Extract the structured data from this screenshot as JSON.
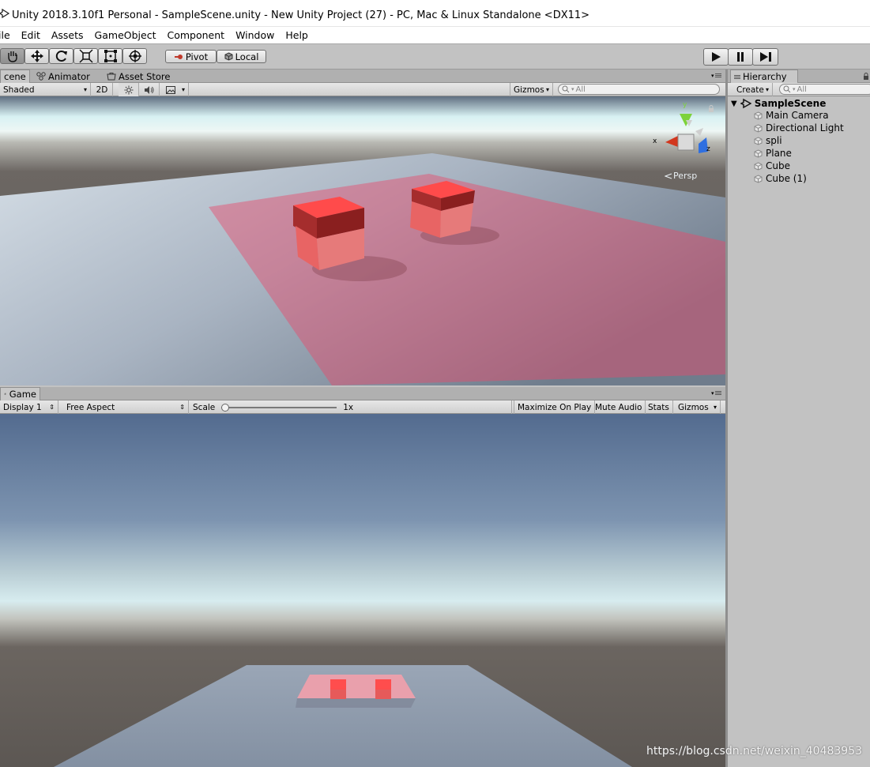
{
  "window": {
    "title": "Unity 2018.3.10f1 Personal - SampleScene.unity - New Unity Project (27) - PC, Mac & Linux Standalone <DX11>"
  },
  "menubar": {
    "items": [
      "ile",
      "Edit",
      "Assets",
      "GameObject",
      "Component",
      "Window",
      "Help"
    ]
  },
  "toolbar": {
    "tools": [
      "hand-tool",
      "move-tool",
      "rotate-tool",
      "scale-tool",
      "rect-tool",
      "transform-tool"
    ],
    "pivot_label": "Pivot",
    "local_label": "Local",
    "playback": [
      "play",
      "pause",
      "step"
    ]
  },
  "scene_panel": {
    "tabs": [
      "cene",
      "Animator",
      "Asset Store"
    ],
    "shading_mode": "Shaded",
    "mode_2d": "2D",
    "gizmos_label": "Gizmos",
    "search_placeholder": "All",
    "gizmo": {
      "x_label": "x",
      "y_label": "y",
      "z_label": "z",
      "persp_label": "Persp"
    }
  },
  "game_panel": {
    "tab": "Game",
    "display": "Display 1",
    "aspect": "Free Aspect",
    "scale_label": "Scale",
    "scale_value": "1x",
    "scale_slider_fraction": 0.0,
    "buttons": [
      "Maximize On Play",
      "Mute Audio",
      "Stats",
      "Gizmos"
    ]
  },
  "hierarchy": {
    "tab": "Hierarchy",
    "create_label": "Create",
    "search_placeholder": "All",
    "scene_name": "SampleScene",
    "items": [
      "Main Camera",
      "Directional Light",
      "spli",
      "Plane",
      "Cube",
      "Cube (1)"
    ]
  },
  "watermark": "https://blog.csdn.net/weixin_40483953",
  "colors": {
    "ui_gray": "#c2c2c2",
    "selected_red": "#e84a4a",
    "y_axis": "#7dd23a",
    "x_axis": "#d2371e",
    "z_axis": "#2f6fe0"
  }
}
